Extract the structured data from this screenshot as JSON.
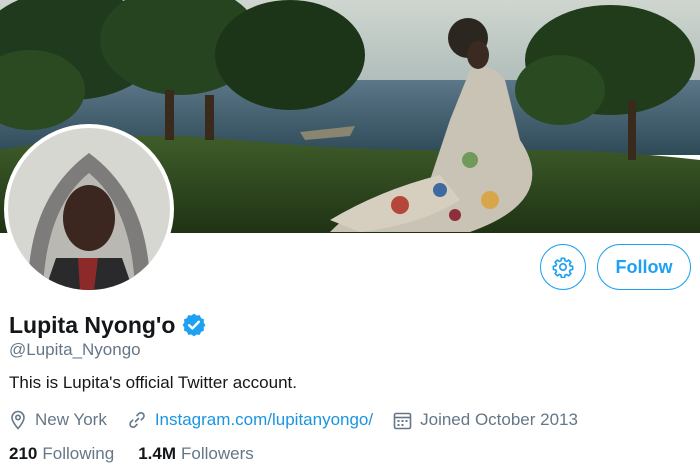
{
  "profile": {
    "display_name": "Lupita Nyong'o",
    "handle": "@Lupita_Nyongo",
    "bio": "This is Lupita's official Twitter account.",
    "location": "New York",
    "website": "Instagram.com/lupitanyongo/",
    "joined": "Joined October 2013"
  },
  "actions": {
    "follow_label": "Follow"
  },
  "stats": {
    "following_count": "210",
    "following_label": "Following",
    "followers_count": "1.4M",
    "followers_label": "Followers"
  },
  "colors": {
    "accent": "#1da1f2",
    "link": "#1b95e0",
    "muted": "#657786",
    "text": "#14171a"
  },
  "icons": {
    "settings": "gear-icon",
    "verified": "verified-badge-icon",
    "location": "location-pin-icon",
    "website": "link-icon",
    "joined": "calendar-icon"
  }
}
